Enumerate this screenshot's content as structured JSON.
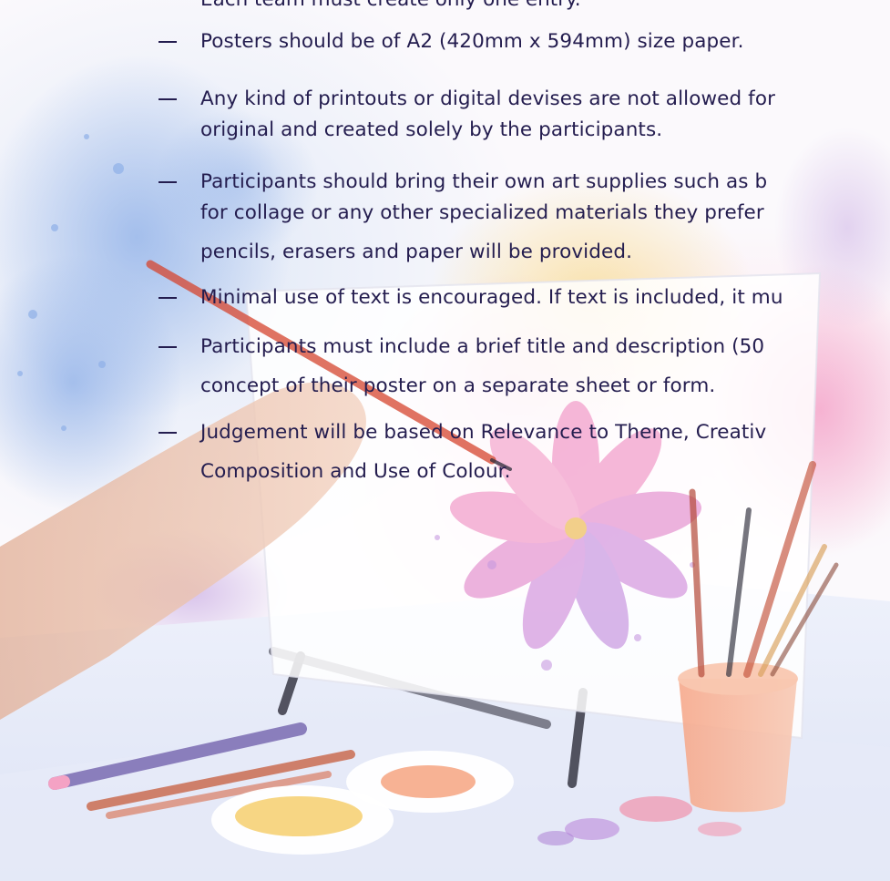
{
  "rules": {
    "top_partial": "Each team must create only one entry.",
    "items": [
      {
        "lines": [
          "Posters should be of A2 (420mm x 594mm) size paper."
        ]
      },
      {
        "lines": [
          "Any kind of printouts or digital devises are not allowed for",
          "original and created solely by the participants."
        ]
      },
      {
        "lines": [
          "Participants should bring their own art supplies such as b",
          "for collage or any other specialized materials they prefer",
          "pencils, erasers and paper will be provided."
        ]
      },
      {
        "lines": [
          "Minimal use of text is encouraged. If text is included, it mu"
        ]
      },
      {
        "lines": [
          "Participants must include a brief title and description (50",
          "concept of their poster on a separate sheet or form."
        ]
      },
      {
        "lines": [
          "Judgement will be based on Relevance to Theme, Creativ",
          "Composition and Use of Colour."
        ]
      }
    ]
  },
  "colors": {
    "text": "#241d4f",
    "background": "#fbf9fc",
    "watercolor_blue": "#9fb9e6",
    "watercolor_pink": "#f2a6cc",
    "watercolor_orange": "#f7b48c",
    "watercolor_yellow": "#f6d58a",
    "watercolor_purple": "#b99ad9"
  },
  "icons": {
    "background": "watercolor-art-supplies-illustration"
  }
}
